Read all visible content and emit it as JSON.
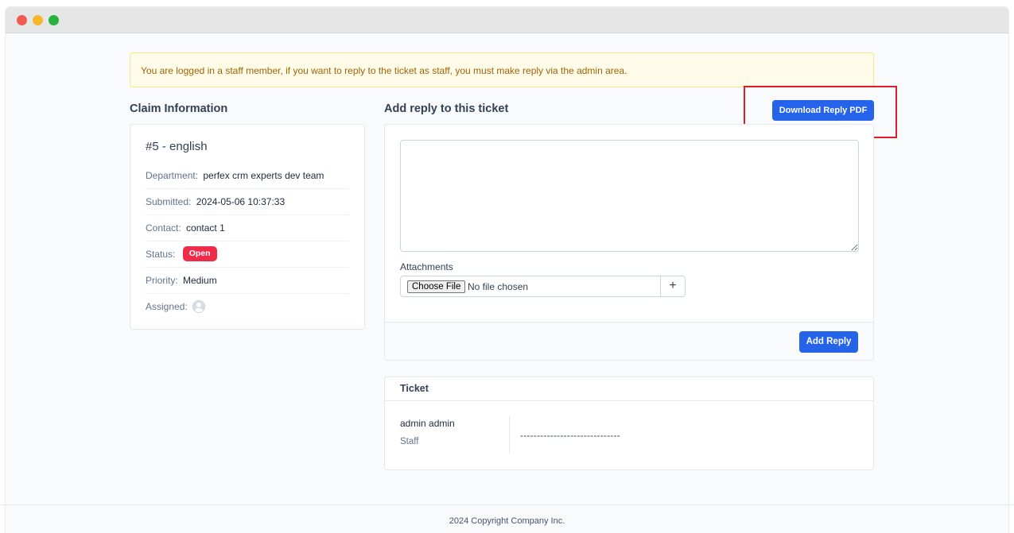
{
  "alert": {
    "text": "You are logged in a staff member, if you want to reply to the ticket as staff, you must make reply via the admin area."
  },
  "claim": {
    "section_title": "Claim Information",
    "ticket_name": "#5 - english",
    "department_label": "Department:",
    "department_value": "perfex crm experts dev team",
    "submitted_label": "Submitted:",
    "submitted_value": "2024-05-06 10:37:33",
    "contact_label": "Contact:",
    "contact_value": "contact 1",
    "status_label": "Status:",
    "status_value": "Open",
    "priority_label": "Priority:",
    "priority_value": "Medium",
    "assigned_label": "Assigned:"
  },
  "reply": {
    "section_title": "Add reply to this ticket",
    "download_pdf_label": "Download Reply PDF",
    "textarea_value": "",
    "attachments_label": "Attachments",
    "choose_file_label": "Choose File",
    "no_file_text": "No file chosen",
    "add_attachment_label": "+",
    "add_reply_label": "Add Reply"
  },
  "ticket": {
    "header": "Ticket",
    "author_name": "admin admin",
    "author_role": "Staff",
    "message": "------------------------------"
  },
  "footer": {
    "copyright": "2024 Copyright Company Inc."
  },
  "colors": {
    "primary": "#2563eb",
    "status_open": "#ef2b4a",
    "highlight": "#e11d2a",
    "alert_bg": "#fefce8",
    "alert_text": "#a16207"
  }
}
